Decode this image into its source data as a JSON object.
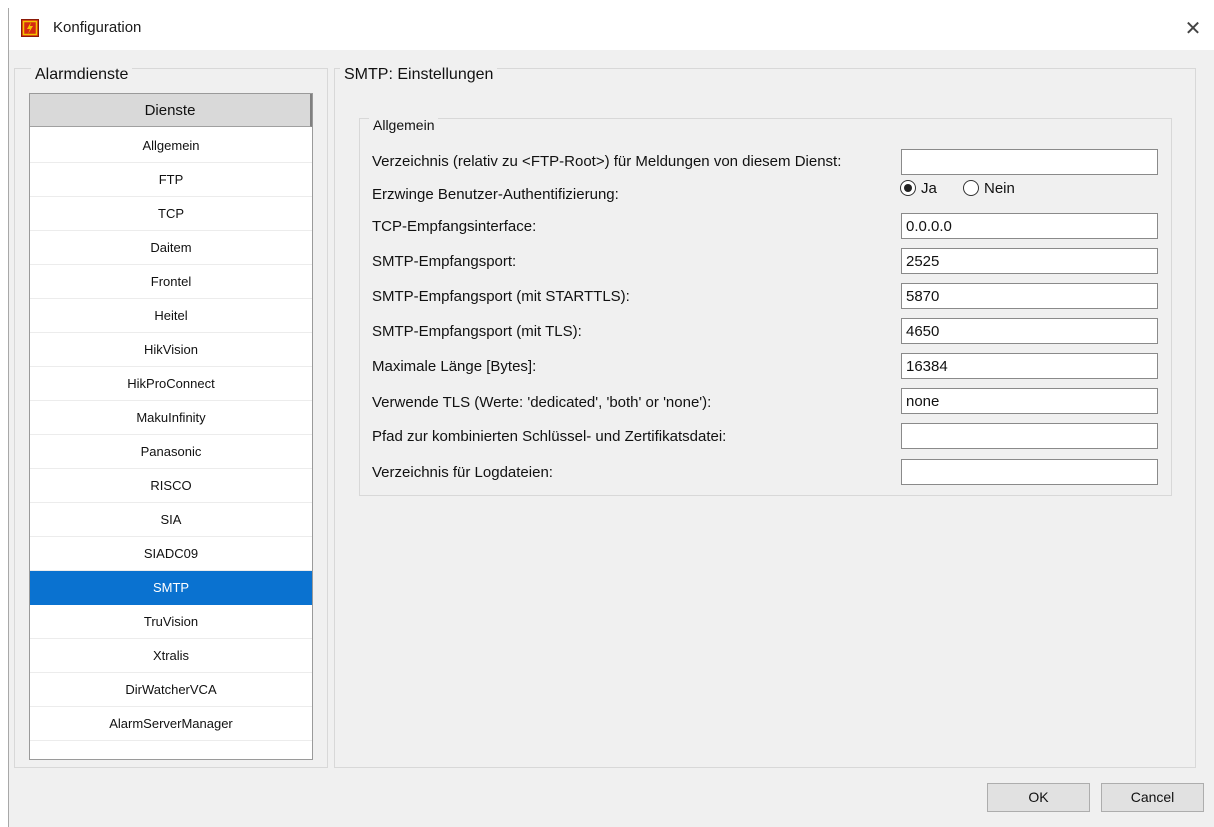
{
  "window": {
    "title": "Konfiguration"
  },
  "left_panel": {
    "group_title": "Alarmdienste",
    "list_header": "Dienste",
    "items": [
      {
        "label": "Allgemein",
        "selected": false
      },
      {
        "label": "FTP",
        "selected": false
      },
      {
        "label": "TCP",
        "selected": false
      },
      {
        "label": "Daitem",
        "selected": false
      },
      {
        "label": "Frontel",
        "selected": false
      },
      {
        "label": "Heitel",
        "selected": false
      },
      {
        "label": "HikVision",
        "selected": false
      },
      {
        "label": "HikProConnect",
        "selected": false
      },
      {
        "label": "MakuInfinity",
        "selected": false
      },
      {
        "label": "Panasonic",
        "selected": false
      },
      {
        "label": "RISCO",
        "selected": false
      },
      {
        "label": "SIA",
        "selected": false
      },
      {
        "label": "SIADC09",
        "selected": false
      },
      {
        "label": "SMTP",
        "selected": true
      },
      {
        "label": "TruVision",
        "selected": false
      },
      {
        "label": "Xtralis",
        "selected": false
      },
      {
        "label": "DirWatcherVCA",
        "selected": false
      },
      {
        "label": "AlarmServerManager",
        "selected": false
      }
    ]
  },
  "settings": {
    "group_title": "SMTP: Einstellungen",
    "section_title": "Allgemein",
    "directory": {
      "label": "Verzeichnis (relativ zu <FTP-Root>) für Meldungen von diesem Dienst:",
      "value": ""
    },
    "auth": {
      "label": "Erzwinge Benutzer-Authentifizierung:",
      "option_yes": "Ja",
      "option_no": "Nein",
      "selected": "Ja"
    },
    "tcp_interface": {
      "label": "TCP-Empfangsinterface:",
      "value": "0.0.0.0"
    },
    "smtp_port": {
      "label": "SMTP-Empfangsport:",
      "value": "2525"
    },
    "smtp_port_starttls": {
      "label": "SMTP-Empfangsport (mit STARTTLS):",
      "value": "5870"
    },
    "smtp_port_tls": {
      "label": "SMTP-Empfangsport (mit TLS):",
      "value": "4650"
    },
    "max_length": {
      "label": "Maximale Länge [Bytes]:",
      "value": "16384"
    },
    "use_tls": {
      "label": "Verwende TLS (Werte: 'dedicated', 'both' or 'none'):",
      "value": "none"
    },
    "cert_path": {
      "label": "Pfad zur kombinierten Schlüssel- und Zertifikatsdatei:",
      "value": ""
    },
    "log_dir": {
      "label": "Verzeichnis für Logdateien:",
      "value": ""
    }
  },
  "buttons": {
    "ok": "OK",
    "cancel": "Cancel"
  },
  "colors": {
    "selection": "#0a72d0",
    "app_icon": "#d52a12"
  }
}
